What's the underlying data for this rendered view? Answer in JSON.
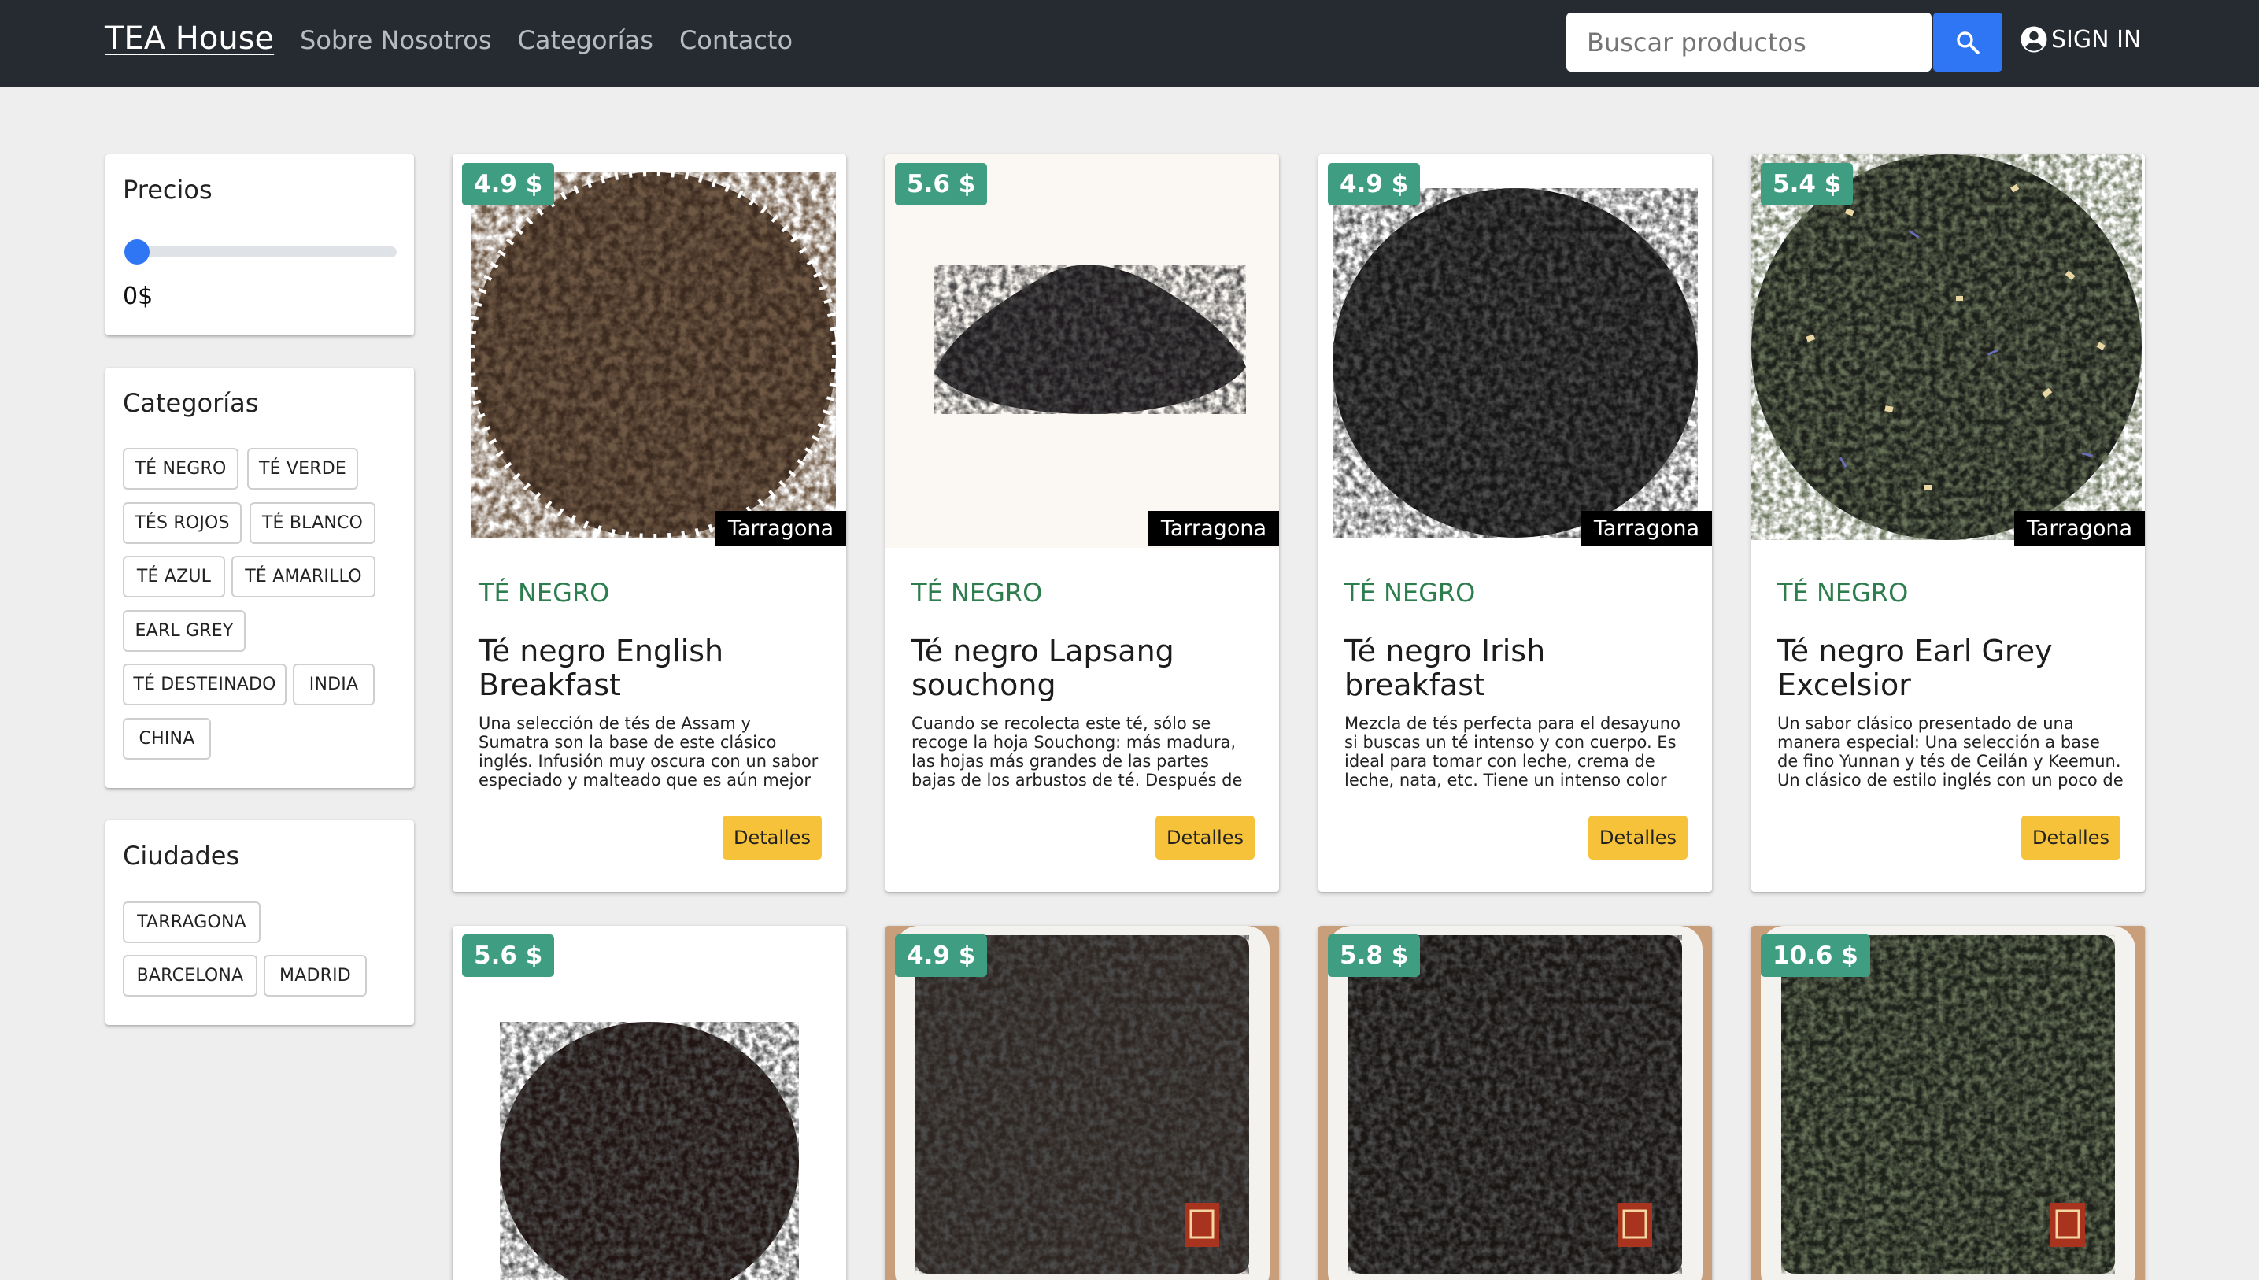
{
  "navbar": {
    "brand": "TEA House",
    "links": [
      "Sobre Nosotros",
      "Categorías",
      "Contacto"
    ],
    "search_placeholder": "Buscar productos",
    "signin_label": "SIGN IN"
  },
  "sidebar": {
    "prices": {
      "title": "Precios",
      "value_label": "0$",
      "slider_value": 0
    },
    "categories": {
      "title": "Categorías",
      "chips": [
        "TÉ NEGRO",
        "TÉ VERDE",
        "TÉS ROJOS",
        "TÉ BLANCO",
        "TÉ AZUL",
        "TÉ AMARILLO",
        "EARL GREY",
        "TÉ DESTEINADO",
        "INDIA",
        "CHINA"
      ]
    },
    "cities": {
      "title": "Ciudades",
      "chips": [
        "TARRAGONA",
        "BARCELONA",
        "MADRID"
      ]
    }
  },
  "products": [
    {
      "price": "4.9 $",
      "city": "Tarragona",
      "category": "TÉ NEGRO",
      "title": "Té negro English Breakfast",
      "description": "Una selección de tés de Assam y Sumatra son la base de este clásico inglés. Infusión muy oscura con un sabor especiado y malteado que es aún mejor cuando se",
      "button": "Detalles",
      "image": "loose-black-tea-heap-icon"
    },
    {
      "price": "5.6 $",
      "city": "Tarragona",
      "category": "TÉ NEGRO",
      "title": "Té negro Lapsang souchong",
      "description": "Cuando se recolecta este té, sólo se recoge la hoja Souchong: más madura, las hojas más grandes de las partes bajas de los arbustos de té. Después de la",
      "button": "Detalles",
      "image": "small-tea-pile-icon"
    },
    {
      "price": "4.9 $",
      "city": "Tarragona",
      "category": "TÉ NEGRO",
      "title": "Té negro Irish breakfast",
      "description": "Mezcla de tés perfecta para el desayuno si buscas un té intenso y con cuerpo. Es ideal para tomar con leche, crema de leche, nata, etc. Tiene un intenso color",
      "button": "Detalles",
      "image": "round-tea-heap-icon"
    },
    {
      "price": "5.4 $",
      "city": "Tarragona",
      "category": "TÉ NEGRO",
      "title": "Té negro Earl Grey Excelsior",
      "description": "Un sabor clásico presentado de una manera especial: Una selección a base de fino Yunnan y tés de Ceilán y Keemun. Un clásico de estilo inglés con un poco de",
      "button": "Detalles",
      "image": "earl-grey-blend-icon"
    },
    {
      "price": "5.6 $",
      "image": "round-tea-heap-icon"
    },
    {
      "price": "4.9 $",
      "image": "tea-bowl-icon"
    },
    {
      "price": "5.8 $",
      "image": "tea-bowl-icon"
    },
    {
      "price": "10.6 $",
      "image": "tea-bowl-icon"
    }
  ],
  "colors": {
    "navbar": "#262a31",
    "accent_blue": "#2f76f5",
    "price_badge": "#3f9d82",
    "category_green": "#2e7d4f",
    "details_button": "#f5c23a"
  }
}
